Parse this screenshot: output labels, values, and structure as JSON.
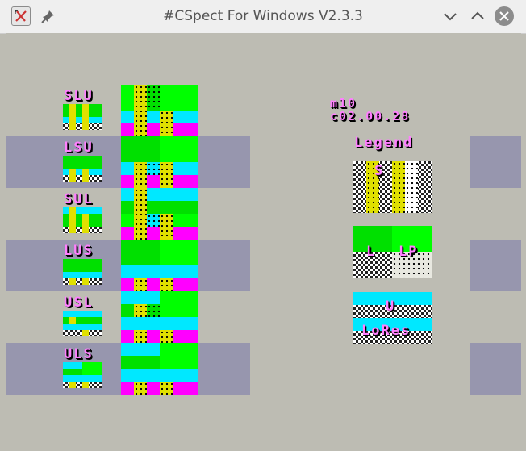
{
  "window": {
    "title": "#CSpect For Windows V2.3.3"
  },
  "titlebar": {
    "app_icon": "cspect-app-icon",
    "pin_icon": "pin-icon",
    "minimize_icon": "chevron-down-icon",
    "maximize_icon": "chevron-up-icon",
    "close_icon": "close-icon"
  },
  "emulator": {
    "layer_orders": [
      "SLU",
      "LSU",
      "SUL",
      "LUS",
      "USL",
      "ULS"
    ],
    "version_line1": "m10",
    "version_line2": "c02.00.28",
    "legend": {
      "title": "Legend",
      "sprites_label": "S",
      "layer2_label": "L",
      "layer2_priority_label": "LP",
      "ula_label": "U",
      "lores_label": "LoRes"
    },
    "colors": {
      "band": "#9796ae",
      "background": "#bdbcb3",
      "green": "#00ff00",
      "dark_green": "#00e000",
      "cyan": "#00e8ff",
      "magenta": "#ff00ff",
      "yellow": "#e0e000",
      "text": "#ff7fff"
    }
  }
}
